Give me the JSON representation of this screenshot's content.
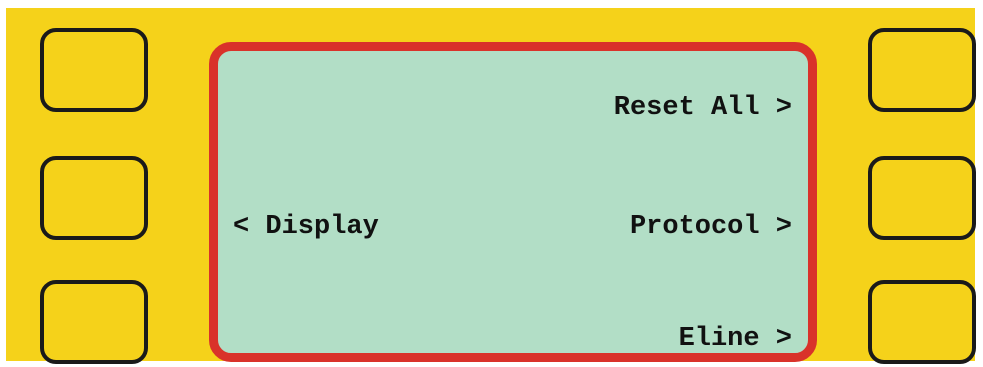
{
  "display": {
    "left_menu": [
      {
        "label": ""
      },
      {
        "label": "< Display"
      },
      {
        "label": ""
      }
    ],
    "right_menu": [
      {
        "label": "Reset All >"
      },
      {
        "label": "Protocol >"
      },
      {
        "label": "Eline >"
      }
    ]
  },
  "colors": {
    "panel": "#f5d21a",
    "screen_background": "#b2dec6",
    "screen_border": "#d9322a",
    "key_outline": "#1a1a1a"
  }
}
